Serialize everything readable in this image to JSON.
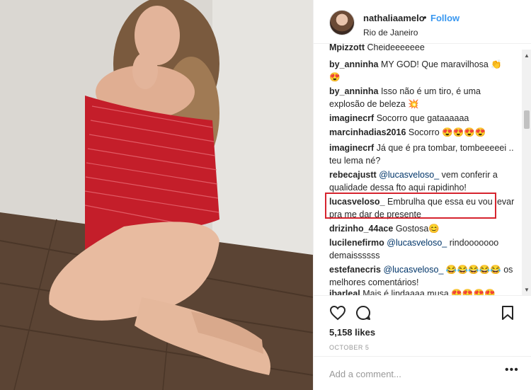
{
  "header": {
    "username": "nathaliaamelo",
    "separator": "•",
    "follow_label": "Follow",
    "location": "Rio de Janeiro"
  },
  "comments": [
    {
      "user": "Mpizzott",
      "text": "Cheideeeeeee"
    },
    {
      "user": "by_anninha",
      "text": "MY GOD! Que maravilhosa 👏 😍"
    },
    {
      "user": "by_anninha",
      "text": "Isso não é um tiro, é uma explosão de beleza 💥"
    },
    {
      "user": "imaginecrf",
      "text": "Socorro que gataaaaaa"
    },
    {
      "user": "marcinhadias2016",
      "text": "Socorro 😍😍😍😍"
    },
    {
      "user": "imaginecrf",
      "text": "Já que é pra tombar, tombeeeeei .. teu lema né?"
    },
    {
      "user": "rebecajustt",
      "mention": "@lucasveloso_",
      "text": " vem conferir a qualidade dessa fto aqui rapidinho!"
    },
    {
      "user": "lucasveloso_",
      "text": "Embrulha que essa eu vou levar pra me dar de presente"
    },
    {
      "user": "drizinho_44ace",
      "text": "Gostosa😊"
    },
    {
      "user": "lucilenefirmo",
      "mention": "@lucasveloso_",
      "text": " rindooooooo demaissssss"
    },
    {
      "user": "estefanecris",
      "mention": "@lucasveloso_",
      "text": " 😂😂😂😂😂 os melhores comentários!"
    },
    {
      "user": "ibarleal",
      "text": "Mais é lindaaaa musa 😍😍😍😍"
    }
  ],
  "post": {
    "likes": "5,158 likes",
    "date": "OCTOBER 5"
  },
  "add_comment": {
    "placeholder": "Add a comment...",
    "more": "•••"
  },
  "colors": {
    "accent": "#3897f0",
    "highlight": "#d6242e",
    "mention": "#003569"
  }
}
